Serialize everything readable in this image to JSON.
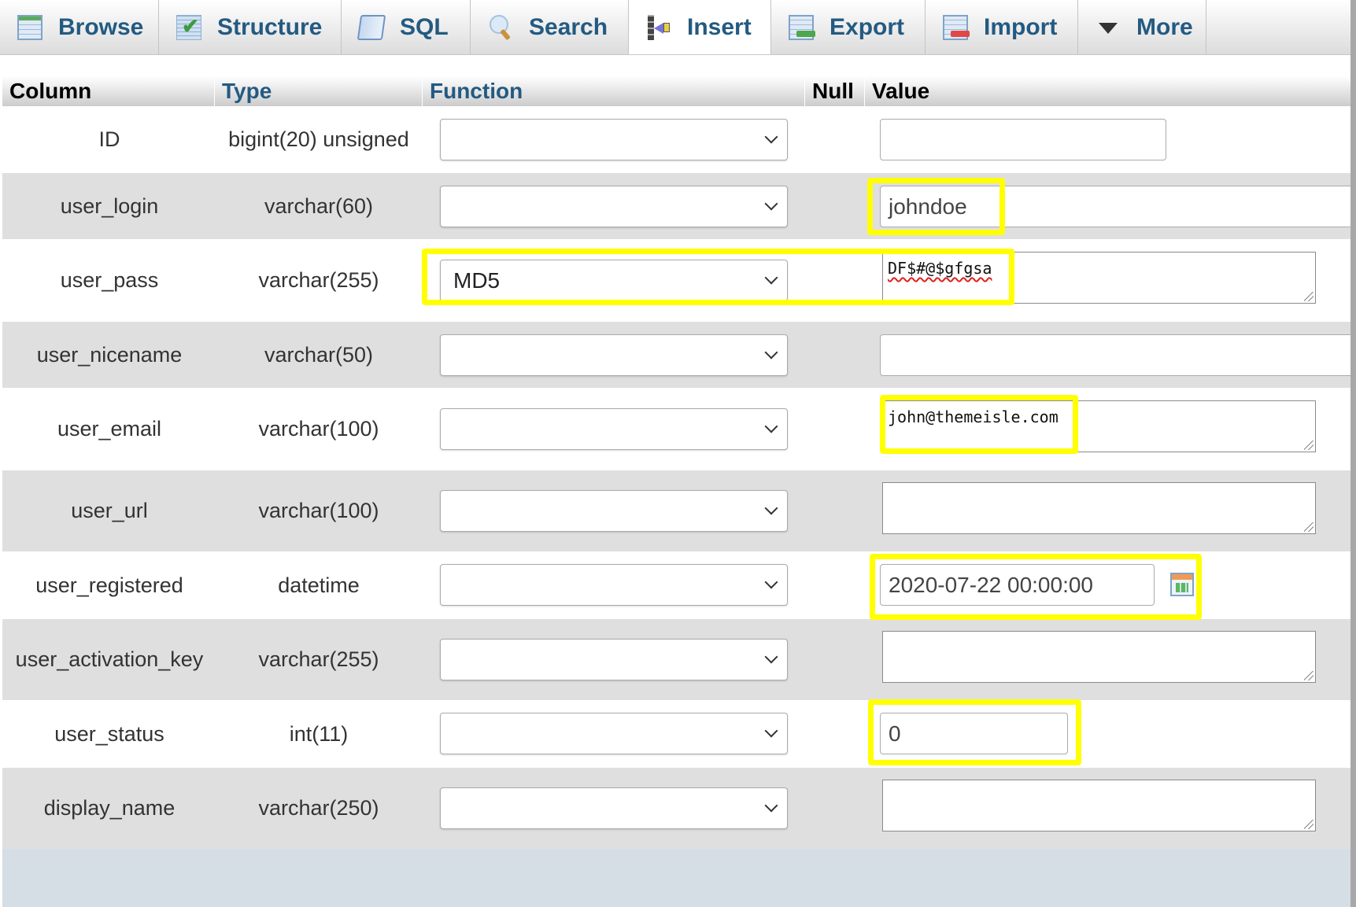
{
  "tabs": [
    {
      "label": "Browse",
      "icon": "browse-icon",
      "active": false
    },
    {
      "label": "Structure",
      "icon": "structure-icon",
      "active": false
    },
    {
      "label": "SQL",
      "icon": "sql-icon",
      "active": false
    },
    {
      "label": "Search",
      "icon": "search-icon",
      "active": false
    },
    {
      "label": "Insert",
      "icon": "insert-icon",
      "active": true
    },
    {
      "label": "Export",
      "icon": "export-icon",
      "active": false
    },
    {
      "label": "Import",
      "icon": "import-icon",
      "active": false
    },
    {
      "label": "More",
      "icon": "dropdown-triangle-icon",
      "active": false
    }
  ],
  "table": {
    "headers": {
      "column": "Column",
      "type": "Type",
      "function": "Function",
      "null": "Null",
      "value": "Value"
    },
    "rows": [
      {
        "column": "ID",
        "type": "bigint(20) unsigned",
        "function": "",
        "value": ""
      },
      {
        "column": "user_login",
        "type": "varchar(60)",
        "function": "",
        "value": "johndoe"
      },
      {
        "column": "user_pass",
        "type": "varchar(255)",
        "function": "MD5",
        "value": "DF$#@$gfgsa"
      },
      {
        "column": "user_nicename",
        "type": "varchar(50)",
        "function": "",
        "value": ""
      },
      {
        "column": "user_email",
        "type": "varchar(100)",
        "function": "",
        "value": "john@themeisle.com"
      },
      {
        "column": "user_url",
        "type": "varchar(100)",
        "function": "",
        "value": ""
      },
      {
        "column": "user_registered",
        "type": "datetime",
        "function": "",
        "value": "2020-07-22 00:00:00"
      },
      {
        "column": "user_activation_key",
        "type": "varchar(255)",
        "function": "",
        "value": ""
      },
      {
        "column": "user_status",
        "type": "int(11)",
        "function": "",
        "value": "0"
      },
      {
        "column": "display_name",
        "type": "varchar(250)",
        "function": "",
        "value": ""
      }
    ]
  },
  "colors": {
    "tab_text": "#235a81",
    "highlight": "#ffff00",
    "row_alt": "#dfdfdf",
    "footer_band": "#d5dde5"
  }
}
